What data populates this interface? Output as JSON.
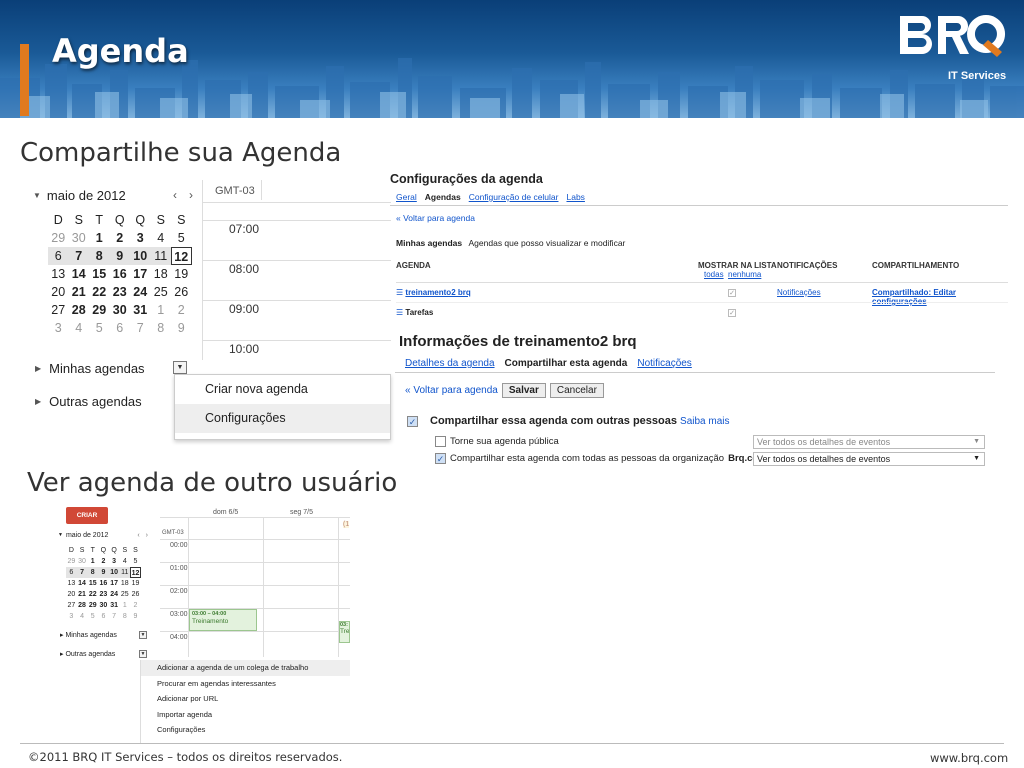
{
  "header": {
    "title": "Agenda",
    "brand_sub": "IT Services",
    "accent": "#e07a1f"
  },
  "sections": {
    "share": "Compartilhe sua Agenda",
    "view_other": "Ver agenda de outro usuário"
  },
  "mini_calendar": {
    "month": "maio de 2012",
    "prev": "‹",
    "next": "›",
    "weekdays": [
      "D",
      "S",
      "T",
      "Q",
      "Q",
      "S",
      "S"
    ],
    "weeks": [
      [
        "29",
        "30",
        "1",
        "2",
        "3",
        "4",
        "5"
      ],
      [
        "6",
        "7",
        "8",
        "9",
        "10",
        "11",
        "12"
      ],
      [
        "13",
        "14",
        "15",
        "16",
        "17",
        "18",
        "19"
      ],
      [
        "20",
        "21",
        "22",
        "23",
        "24",
        "25",
        "26"
      ],
      [
        "27",
        "28",
        "29",
        "30",
        "31",
        "1",
        "2"
      ],
      [
        "3",
        "4",
        "5",
        "6",
        "7",
        "8",
        "9"
      ]
    ],
    "today": "12"
  },
  "sidebar": {
    "my_calendars": "Minhas agendas",
    "other_calendars": "Outras agendas"
  },
  "dayview": {
    "timezone": "GMT-03",
    "hours": [
      "07:00",
      "08:00",
      "09:00",
      "10:00"
    ]
  },
  "menu1": {
    "items": [
      "Criar nova agenda",
      "Configurações"
    ]
  },
  "settings": {
    "title": "Configurações da agenda",
    "tabs": [
      "Geral",
      "Agendas",
      "Configuração de celular",
      "Labs"
    ],
    "back": "« Voltar para agenda",
    "my_cal_label": "Minhas agendas",
    "my_cal_desc": "Agendas que posso visualizar e modificar",
    "col_agenda": "AGENDA",
    "col_show": "MOSTRAR NA LISTA",
    "col_show_all": "todas",
    "col_show_none": "nenhuma",
    "col_notif": "NOTIFICAÇÕES",
    "col_share": "COMPARTILHAMENTO",
    "rows": [
      {
        "name": "treinamento2 brq",
        "notif": "Notificações",
        "share": "Compartilhado: Editar configurações"
      },
      {
        "name": "Tarefas",
        "notif": "",
        "share": ""
      }
    ]
  },
  "info": {
    "title": "Informações de treinamento2 brq",
    "tabs": [
      "Detalhes da agenda",
      "Compartilhar esta agenda",
      "Notificações"
    ],
    "back": "« Voltar para agenda",
    "save": "Salvar",
    "cancel": "Cancelar",
    "share_label": "Compartilhar essa agenda com outras pessoas",
    "learn_more": "Saiba mais",
    "public_label": "Torne sua agenda pública",
    "org_label": "Compartilhar esta agenda com todas as pessoas da organização",
    "org_name": "Brq.com",
    "public_select": "Ver todos os detalhes de eventos",
    "org_select": "Ver todos os detalhes de eventos"
  },
  "small_shot": {
    "create": "CRIAR",
    "col1": "dom 6/5",
    "col2": "seg 7/5",
    "timezone": "GMT-03",
    "hours": [
      "00:00",
      "01:00",
      "02:00",
      "03:00",
      "04:00"
    ],
    "event_time": "03:00 – 04:00",
    "event_title": "Treinamento",
    "event2_time": "03:",
    "event2_title": "Tre",
    "col3_partial": "(1"
  },
  "menu2": {
    "items": [
      "Adicionar a agenda de um colega de trabalho",
      "Procurar em agendas interessantes",
      "Adicionar por URL",
      "Importar agenda",
      "Configurações"
    ]
  },
  "footer": {
    "copyright": "©2011 BRQ IT Services – todos os direitos reservados.",
    "site": "www.brq.com"
  }
}
